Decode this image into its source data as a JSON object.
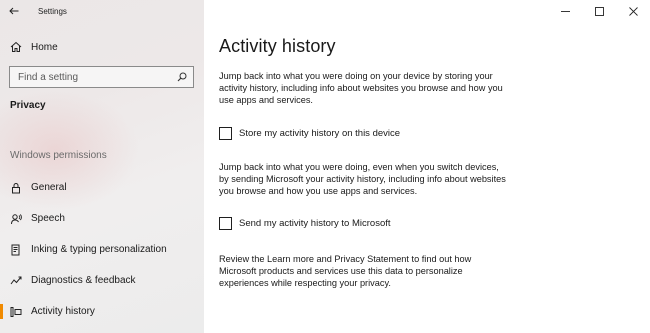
{
  "window": {
    "app_title": "Settings"
  },
  "sidebar": {
    "home_label": "Home",
    "search_placeholder": "Find a setting",
    "section_title": "Privacy",
    "group_header": "Windows permissions",
    "items": [
      {
        "label": "General",
        "icon": "lock-icon"
      },
      {
        "label": "Speech",
        "icon": "speech-icon"
      },
      {
        "label": "Inking & typing personalization",
        "icon": "inking-icon"
      },
      {
        "label": "Diagnostics & feedback",
        "icon": "diagnostics-icon"
      },
      {
        "label": "Activity history",
        "icon": "activity-history-icon",
        "active": true
      }
    ]
  },
  "main": {
    "title": "Activity history",
    "para1": "Jump back into what you were doing on your device by storing your activity history, including info about websites you browse and how you use apps and services.",
    "checkbox1_label": "Store my activity history on this device",
    "para2": "Jump back into what you were doing, even when you switch devices, by sending Microsoft your activity history, including info about websites you browse and how you use apps and services.",
    "checkbox2_label": "Send my activity history to Microsoft",
    "para3": "Review the Learn more and Privacy Statement to find out how Microsoft products and services use this data to personalize experiences while respecting your privacy."
  },
  "colors": {
    "accent": "#f08a00"
  }
}
